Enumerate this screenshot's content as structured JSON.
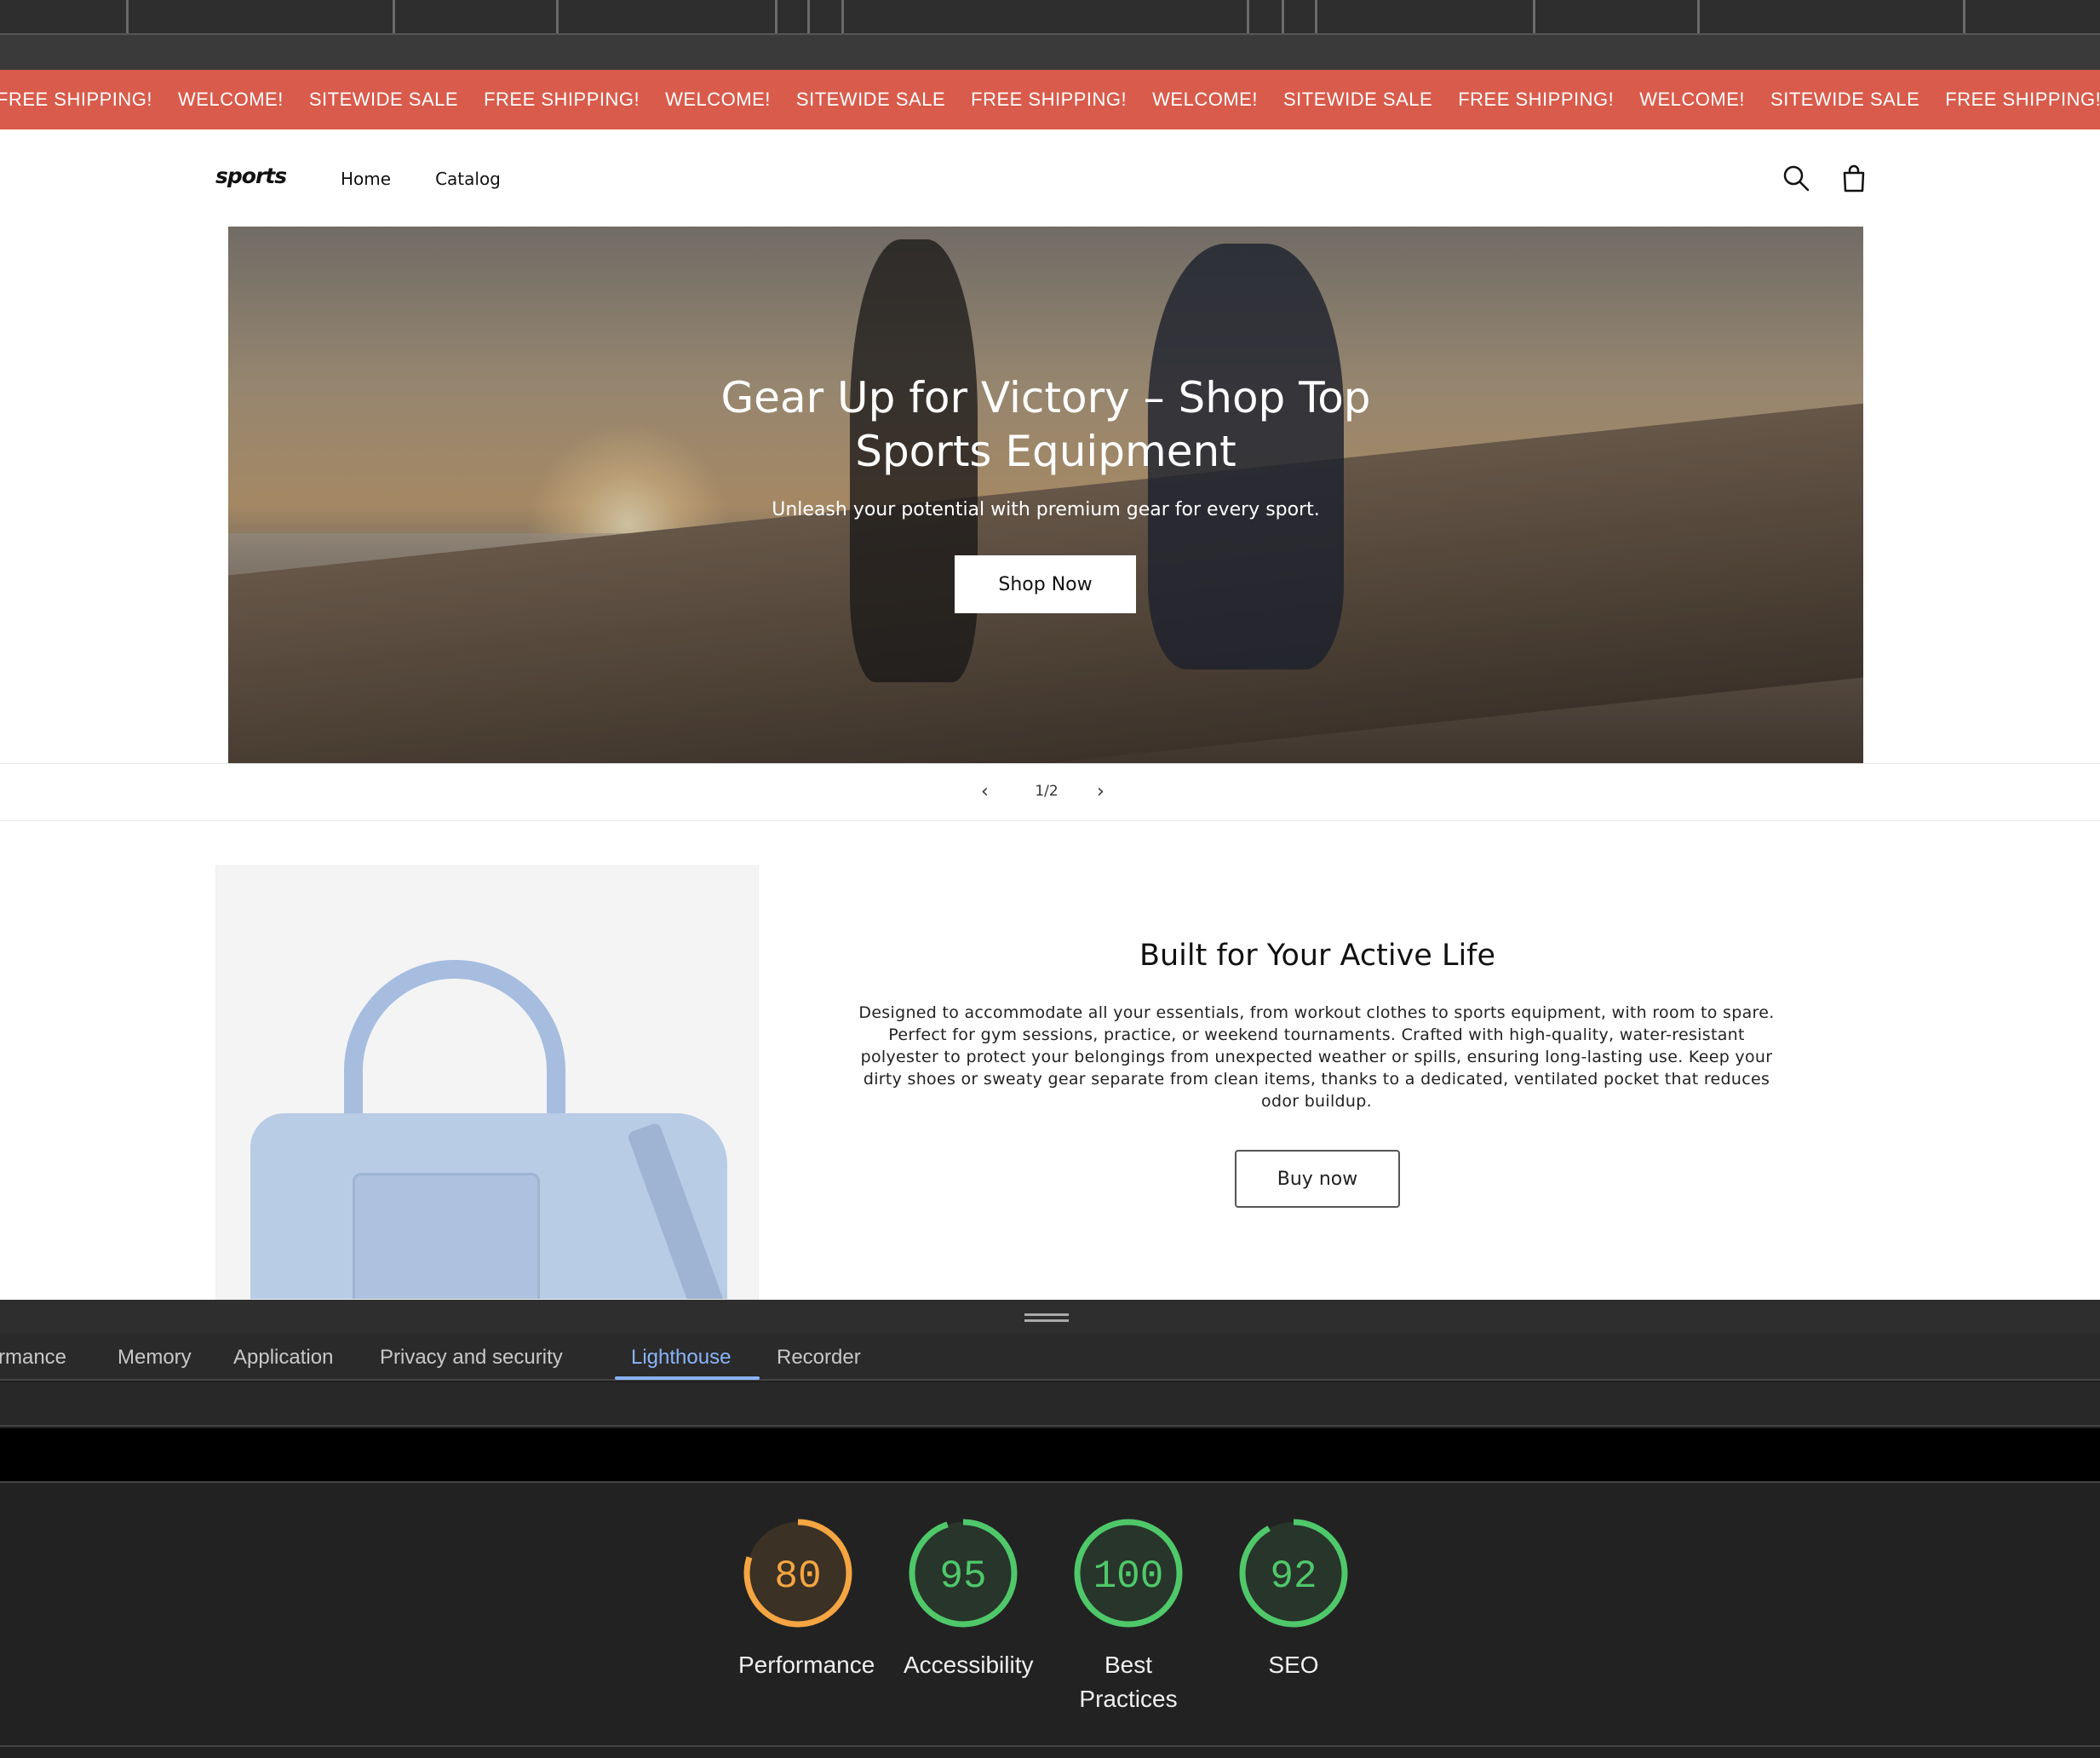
{
  "announcement": {
    "items": [
      "FREE SHIPPING!",
      "WELCOME!",
      "SITEWIDE SALE",
      "FREE SHIPPING!",
      "WELCOME!",
      "SITEWIDE SALE",
      "FREE SHIPPING!",
      "WELCOME!",
      "SITEWIDE SALE",
      "FREE SHIPPING!",
      "WELCOME!",
      "SITEWIDE SALE",
      "FREE SHIPPING!"
    ]
  },
  "header": {
    "logo": "sports",
    "nav": [
      "Home",
      "Catalog"
    ],
    "icons": [
      "search-icon",
      "cart-icon"
    ]
  },
  "hero": {
    "title": "Gear Up for Victory – Shop Top Sports Equipment",
    "subtitle": "Unleash your potential with premium gear for every sport.",
    "button": "Shop Now"
  },
  "slider": {
    "counter": "1/2",
    "prev": "‹",
    "next": "›"
  },
  "feature": {
    "title": "Built for Your Active Life",
    "text": "Designed to accommodate all your essentials, from workout clothes to sports equipment, with room to spare. Perfect for gym sessions, practice, or weekend tournaments. Crafted with high-quality, water-resistant polyester to protect your belongings from unexpected weather or spills, ensuring long-lasting use. Keep your dirty shoes or sweaty gear separate from clean items, thanks to a dedicated, ventilated pocket that reduces odor buildup.",
    "button": "Buy now"
  },
  "devtools": {
    "tabs": [
      "rmance",
      "Memory",
      "Application",
      "Privacy and security",
      "Lighthouse",
      "Recorder"
    ],
    "active_tab": "Lighthouse",
    "scores": [
      {
        "label": "Performance",
        "value": 80,
        "color": "#f5a541"
      },
      {
        "label": "Accessibility",
        "value": 95,
        "color": "#4fc86a"
      },
      {
        "label": "Best Practices",
        "value": 100,
        "color": "#4fc86a"
      },
      {
        "label": "SEO",
        "value": 92,
        "color": "#4fc86a"
      }
    ]
  }
}
